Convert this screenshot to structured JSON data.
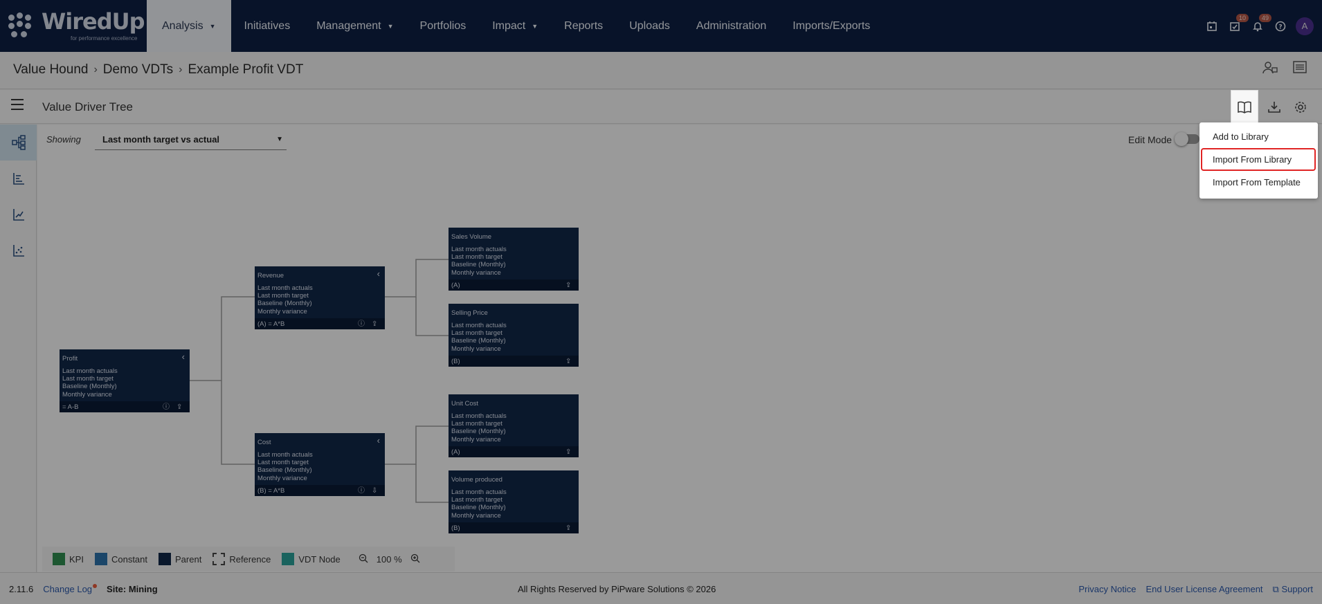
{
  "logo": {
    "name": "WiredUp",
    "tagline": "for performance excellence"
  },
  "nav": {
    "items": [
      {
        "label": "Analysis",
        "caret": true,
        "active": true
      },
      {
        "label": "Initiatives",
        "caret": false
      },
      {
        "label": "Management",
        "caret": true
      },
      {
        "label": "Portfolios",
        "caret": false
      },
      {
        "label": "Impact",
        "caret": true
      },
      {
        "label": "Reports",
        "caret": false
      },
      {
        "label": "Uploads",
        "caret": false
      },
      {
        "label": "Administration",
        "caret": false
      },
      {
        "label": "Imports/Exports",
        "caret": false
      }
    ],
    "badge_tasks": "10",
    "badge_notifications": "49",
    "avatar": "A"
  },
  "breadcrumb": [
    "Value Hound",
    "Demo VDTs",
    "Example Profit VDT"
  ],
  "toolbar": {
    "title": "Value Driver Tree"
  },
  "filter": {
    "label": "Showing",
    "value": "Last month target vs actual"
  },
  "edit_mode": {
    "label": "Edit Mode",
    "on": false
  },
  "menu": {
    "items": [
      "Add to Library",
      "Import From Library",
      "Import From Template"
    ],
    "highlighted": "Import From Library"
  },
  "tree": {
    "metric_lines": [
      "Last month actuals",
      "Last month target",
      "Baseline (Monthly)",
      "Monthly variance"
    ],
    "nodes": {
      "profit": {
        "title": "Profit",
        "footer": "= A-B"
      },
      "revenue": {
        "title": "Revenue",
        "footer": "(A) = A*B"
      },
      "cost": {
        "title": "Cost",
        "footer": "(B) = A*B"
      },
      "sales_volume": {
        "title": "Sales Volume",
        "footer": "(A)"
      },
      "selling_price": {
        "title": "Selling Price",
        "footer": "(B)"
      },
      "unit_cost": {
        "title": "Unit Cost",
        "footer": "(A)"
      },
      "volume_produced": {
        "title": "Volume produced",
        "footer": "(B)"
      }
    }
  },
  "legend": {
    "items": [
      {
        "label": "KPI",
        "color": "#2f8a4e"
      },
      {
        "label": "Constant",
        "color": "#2c6fa6"
      },
      {
        "label": "Parent",
        "color": "#112646"
      },
      {
        "label": "Reference",
        "color": "dashed"
      },
      {
        "label": "VDT Node",
        "color": "#2a9d96"
      }
    ],
    "zoom": "100 %"
  },
  "footer": {
    "version": "2.11.6",
    "changelog": "Change Log",
    "site": "Site: Mining",
    "copyright": "All Rights Reserved by PiPware Solutions © 2026",
    "privacy": "Privacy Notice",
    "eula": "End User License Agreement",
    "support": "Support"
  }
}
